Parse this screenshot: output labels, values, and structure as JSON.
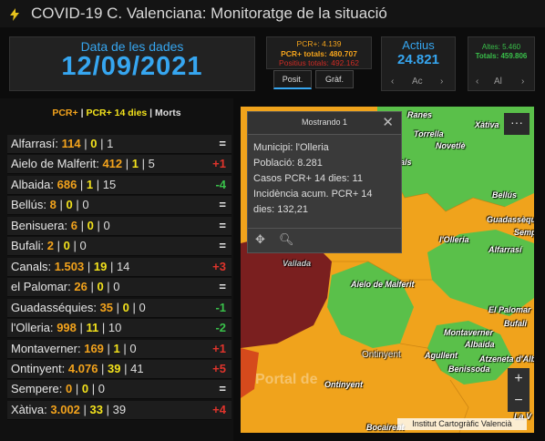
{
  "app": {
    "title": "COVID-19 C. Valenciana: Monitoratge de la situació"
  },
  "date": {
    "label": "Data de les dades",
    "value": "12/09/2021"
  },
  "pcr_summary": {
    "pcr": "PCR+: 4.139",
    "pcr_totals": "PCR+ totals: 480.707",
    "positius_totals": "Positius totals: 492.162"
  },
  "tabs": [
    {
      "label": "Posit."
    },
    {
      "label": "Gràf."
    }
  ],
  "actius": {
    "label": "Actius",
    "value": "24.821",
    "nav_prev": "‹",
    "nav_mid": "Ac",
    "nav_next": "›"
  },
  "altes": {
    "altes": "Altes: 5.460",
    "totals": "Totals: 459.806",
    "nav_prev": "‹",
    "nav_mid": "Al",
    "nav_next": "›"
  },
  "legend": {
    "pcr": "PCR+",
    "sep1": " | ",
    "pcr14": "PCR+ 14 dies",
    "sep2": " | ",
    "morts": "Morts"
  },
  "municipalities": [
    {
      "name": "Alfarrasí:",
      "pcr": "114",
      "pcr14": "0",
      "morts": "1",
      "delta": "=",
      "trend": "eq"
    },
    {
      "name": "Aielo de Malferit:",
      "pcr": "412",
      "pcr14": "1",
      "morts": "5",
      "delta": "+1",
      "trend": "up"
    },
    {
      "name": "Albaida:",
      "pcr": "686",
      "pcr14": "1",
      "morts": "15",
      "delta": "-4",
      "trend": "down"
    },
    {
      "name": "Bellús:",
      "pcr": "8",
      "pcr14": "0",
      "morts": "0",
      "delta": "=",
      "trend": "eq"
    },
    {
      "name": "Benisuera:",
      "pcr": "6",
      "pcr14": "0",
      "morts": "0",
      "delta": "=",
      "trend": "eq"
    },
    {
      "name": "Bufali:",
      "pcr": "2",
      "pcr14": "0",
      "morts": "0",
      "delta": "=",
      "trend": "eq"
    },
    {
      "name": "Canals:",
      "pcr": "1.503",
      "pcr14": "19",
      "morts": "14",
      "delta": "+3",
      "trend": "up"
    },
    {
      "name": "el Palomar:",
      "pcr": "26",
      "pcr14": "0",
      "morts": "0",
      "delta": "=",
      "trend": "eq"
    },
    {
      "name": "Guadasséquies:",
      "pcr": "35",
      "pcr14": "0",
      "morts": "0",
      "delta": "-1",
      "trend": "down"
    },
    {
      "name": "l'Olleria:",
      "pcr": "998",
      "pcr14": "11",
      "morts": "10",
      "delta": "-2",
      "trend": "down"
    },
    {
      "name": "Montaverner:",
      "pcr": "169",
      "pcr14": "1",
      "morts": "0",
      "delta": "+1",
      "trend": "up"
    },
    {
      "name": "Ontinyent:",
      "pcr": "4.076",
      "pcr14": "39",
      "morts": "41",
      "delta": "+5",
      "trend": "up"
    },
    {
      "name": "Sempere:",
      "pcr": "0",
      "pcr14": "0",
      "morts": "0",
      "delta": "=",
      "trend": "eq"
    },
    {
      "name": "Xàtiva:",
      "pcr": "3.002",
      "pcr14": "33",
      "morts": "39",
      "delta": "+4",
      "trend": "up"
    }
  ],
  "popup": {
    "title": "Mostrando 1",
    "close": "✕",
    "line1": "Municipi: l'Olleria",
    "line2": "Població: 8.281",
    "line3": "Casos PCR+ 14 dies: 11",
    "line4": "Incidència acum. PCR+ 14",
    "line5": "dies: 132,21"
  },
  "map": {
    "more": "···",
    "zoom_in": "+",
    "zoom_out": "−",
    "attribution": "Institut Cartogràfic Valencià",
    "watermark": "Portal de",
    "places": [
      {
        "id": "place-ranes",
        "label": "Ranes"
      },
      {
        "id": "place-xativa",
        "label": "Xàtiva"
      },
      {
        "id": "place-torrella",
        "label": "Torrella"
      },
      {
        "id": "place-novetle",
        "label": "Novetlè"
      },
      {
        "id": "place-canals",
        "label": "Canals"
      },
      {
        "id": "place-bellus",
        "label": "Bellús"
      },
      {
        "id": "place-guadasseq",
        "label": "Guadassèquies"
      },
      {
        "id": "place-sempere",
        "label": "Sempe"
      },
      {
        "id": "place-olleria",
        "label": "l'Olleria"
      },
      {
        "id": "place-alfarrasi",
        "label": "Alfarrasí"
      },
      {
        "id": "place-vallada",
        "label": "Vallada"
      },
      {
        "id": "place-aielo",
        "label": "Aielo de Malferit"
      },
      {
        "id": "place-palomar",
        "label": "El Palomar"
      },
      {
        "id": "place-bufali",
        "label": "Bufali"
      },
      {
        "id": "place-montaverner",
        "label": "Montaverner"
      },
      {
        "id": "place-albaida",
        "label": "Albaida"
      },
      {
        "id": "place-agullent",
        "label": "Agullent"
      },
      {
        "id": "place-atzeneta",
        "label": "Atzeneta d'Albai"
      },
      {
        "id": "place-benissoda",
        "label": "Benissoda"
      },
      {
        "id": "place-ontinyent",
        "label": "Ontinyent"
      },
      {
        "id": "place-ontinyent2",
        "label": "Ontinyent"
      },
      {
        "id": "place-bocaire",
        "label": "Bocairent"
      },
      {
        "id": "place-laval",
        "label": "La V"
      }
    ]
  },
  "colors": {
    "accent": "#36a6f0",
    "pcr": "#f3a31c",
    "pcr14": "#f3e21c",
    "up": "#e0342c",
    "down": "#39c04a",
    "map_orange": "#f0a31c",
    "map_green": "#5ac04a",
    "map_darkred": "#7a1f1f"
  }
}
